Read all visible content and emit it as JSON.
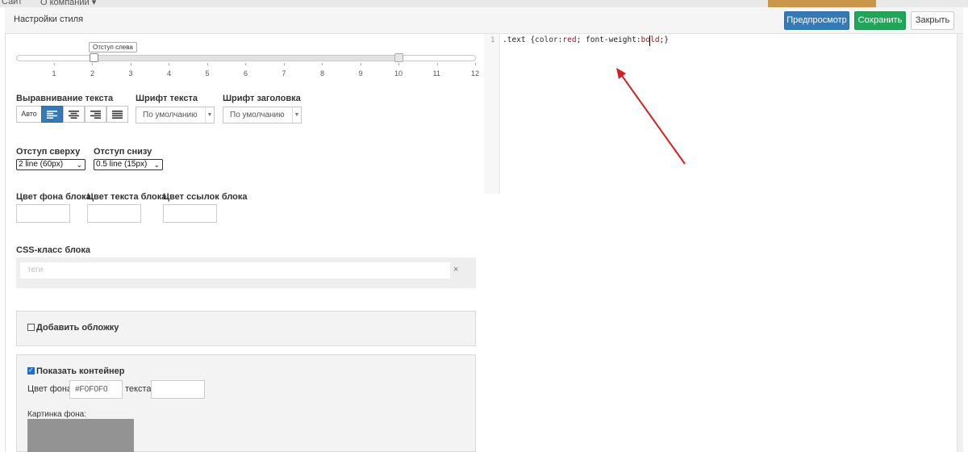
{
  "background": {
    "nav_items": [
      "Сайт",
      "О компании ▾"
    ],
    "accent_color": "#c9964c"
  },
  "modal": {
    "title": "Настройки стиля",
    "buttons": {
      "preview": "Предпросмотр",
      "save": "Сохранить",
      "close": "Закрыть"
    }
  },
  "slider": {
    "tooltip": "Отступ слева",
    "ticks": [
      "1",
      "2",
      "3",
      "4",
      "5",
      "6",
      "7",
      "8",
      "9",
      "10",
      "11",
      "12"
    ],
    "handle_left_value": 2,
    "handle_right_value": 10
  },
  "text_align": {
    "label": "Выравнивание текста",
    "auto_label": "Авто",
    "options": [
      "align-left-icon",
      "align-center-icon",
      "align-right-icon",
      "align-justify-icon"
    ],
    "selected": "align-left-icon"
  },
  "font_text": {
    "label": "Шрифт текста",
    "value": "По умолчанию"
  },
  "font_heading": {
    "label": "Шрифт заголовка",
    "value": "По умолчанию"
  },
  "padding_top": {
    "label": "Отступ сверху",
    "value": "2 line (60px)"
  },
  "padding_bottom": {
    "label": "Отступ снизу",
    "value": "0.5 line (15px)"
  },
  "colors": {
    "bg_label": "Цвет фона блока",
    "text_label": "Цвет текста блока",
    "link_label": "Цвет ссылок блока"
  },
  "css_class": {
    "label": "CSS-класс блока",
    "placeholder": "теги",
    "clear": "×"
  },
  "cover": {
    "label": "Добавить обложку",
    "checked": false
  },
  "container": {
    "label": "Показать контейнер",
    "checked": true,
    "bg_label": "Цвет фона:",
    "bg_value": "#F0F0F0",
    "text_label": "текста:",
    "text_value": "",
    "image_label": "Картинка фона:"
  },
  "editor": {
    "line_number": "1",
    "code_selector": ".text {",
    "code_prop1": "color",
    "code_colon1": ":",
    "code_val1": "red",
    "code_mid": "; font-weight",
    "code_colon2": ":",
    "code_val2": "bold",
    "code_end": ";}"
  }
}
